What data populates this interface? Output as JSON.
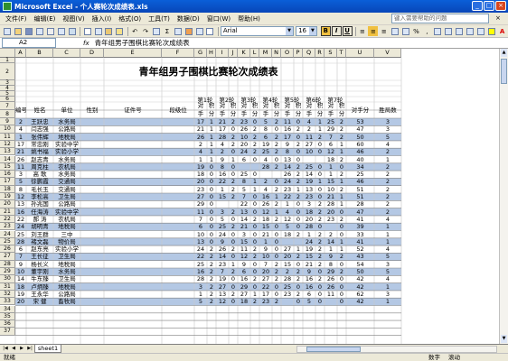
{
  "window": {
    "title": "Microsoft Excel - 个人赛轮次成绩表.xls"
  },
  "menu": {
    "items": [
      "文件(F)",
      "编辑(E)",
      "视图(V)",
      "插入(I)",
      "格式(O)",
      "工具(T)",
      "数据(D)",
      "窗口(W)",
      "帮助(H)"
    ],
    "ask_placeholder": "键入需要帮助的问题",
    "close_glyph": "×"
  },
  "toolbar": {
    "font_name": "Arial",
    "font_size": "16",
    "bold_label": "B",
    "italic_label": "I",
    "underline_label": "U",
    "zoom_sigma": "Σ"
  },
  "formula_bar": {
    "cell_ref": "A2",
    "fx": "fx",
    "value": "青年组男子围棋比赛轮次成绩表"
  },
  "sheet": {
    "columns": [
      "A",
      "B",
      "C",
      "D",
      "E",
      "F",
      "G",
      "H",
      "I",
      "J",
      "K",
      "L",
      "M",
      "N",
      "O",
      "P",
      "Q",
      "R",
      "S",
      "T",
      "U",
      "V"
    ],
    "row_numbers": [
      "1",
      "2",
      "3",
      "4",
      "5",
      "6",
      "7",
      "8",
      "9",
      "10",
      "11",
      "12",
      "13",
      "14",
      "15",
      "16",
      "17",
      "18",
      "19",
      "20",
      "21",
      "22",
      "23",
      "24",
      "25",
      "26",
      "27",
      "28",
      "29",
      "30",
      "31",
      "32",
      "33",
      "34",
      "35",
      "36",
      "37"
    ],
    "title": "青年组男子围棋比赛轮次成绩表",
    "headers": {
      "id": "编号",
      "name": "姓名",
      "unit": "单位",
      "gender": "性别",
      "cert": "证件号",
      "rank": "段级位",
      "rounds": [
        "第1轮",
        "第2轮",
        "第3轮",
        "第4轮",
        "第5轮",
        "第6轮",
        "第7轮"
      ],
      "opp": "对",
      "pts": "积",
      "opp2": "手",
      "pts2": "分",
      "opp_points": "对手分",
      "wins": "胜局数"
    },
    "rows": [
      {
        "id": "2",
        "name": "王跃忠",
        "unit": "水务局",
        "g": [
          "17",
          "1",
          "21",
          "2",
          "23",
          "0",
          "5",
          "2",
          "11",
          "0",
          "4",
          "1",
          "25",
          "2"
        ],
        "opp": "53",
        "win": "3"
      },
      {
        "id": "4",
        "name": "闫志强",
        "unit": "公路局",
        "g": [
          "21",
          "1",
          "17",
          "0",
          "26",
          "2",
          "8",
          "0",
          "16",
          "2",
          "2",
          "1",
          "29",
          "2"
        ],
        "opp": "47",
        "win": "3"
      },
      {
        "id": "1",
        "name": "张伟辉",
        "unit": "地税局",
        "g": [
          "26",
          "1",
          "28",
          "2",
          "10",
          "2",
          "6",
          "2",
          "17",
          "0",
          "11",
          "2",
          "7",
          "2"
        ],
        "opp": "50",
        "win": "5"
      },
      {
        "id": "17",
        "name": "常忠刚",
        "unit": "实验中学",
        "g": [
          "2",
          "1",
          "4",
          "2",
          "20",
          "2",
          "19",
          "2",
          "9",
          "2",
          "27",
          "0",
          "6",
          "1"
        ],
        "opp": "60",
        "win": "4"
      },
      {
        "id": "21",
        "name": "姚书福",
        "unit": "实验小学",
        "g": [
          "4",
          "1",
          "2",
          "0",
          "24",
          "2",
          "25",
          "2",
          "8",
          "0",
          "10",
          "0",
          "12",
          "1"
        ],
        "opp": "46",
        "win": "2"
      },
      {
        "id": "26",
        "name": "赵志青",
        "unit": "水务局",
        "g": [
          "1",
          "1",
          "9",
          "1",
          "6",
          "0",
          "4",
          "0",
          "13",
          "0",
          "",
          "",
          "18",
          "2"
        ],
        "opp": "40",
        "win": "1"
      },
      {
        "id": "11",
        "name": "周克柱",
        "unit": "农机局",
        "g": [
          "19",
          "0",
          "8",
          "0",
          "",
          "",
          "28",
          "2",
          "14",
          "2",
          "25",
          "0",
          "1",
          "0"
        ],
        "opp": "34",
        "win": "2"
      },
      {
        "id": "3",
        "name": "高 歌",
        "unit": "水务局",
        "g": [
          "18",
          "0",
          "16",
          "0",
          "25",
          "0",
          "",
          "",
          "26",
          "2",
          "14",
          "0",
          "1",
          "2"
        ],
        "opp": "25",
        "win": "2"
      },
      {
        "id": "5",
        "name": "徐鹏霞",
        "unit": "交通局",
        "g": [
          "20",
          "0",
          "22",
          "2",
          "8",
          "1",
          "2",
          "0",
          "24",
          "2",
          "19",
          "1",
          "15",
          "1"
        ],
        "opp": "46",
        "win": "2"
      },
      {
        "id": "8",
        "name": "毛长玉",
        "unit": "交通局",
        "g": [
          "23",
          "0",
          "1",
          "2",
          "5",
          "1",
          "4",
          "2",
          "23",
          "1",
          "13",
          "0",
          "10",
          "2"
        ],
        "opp": "51",
        "win": "2"
      },
      {
        "id": "12",
        "name": "李松高",
        "unit": "卫生局",
        "g": [
          "27",
          "0",
          "15",
          "2",
          "7",
          "0",
          "16",
          "1",
          "22",
          "2",
          "23",
          "0",
          "21",
          "1"
        ],
        "opp": "51",
        "win": "2"
      },
      {
        "id": "13",
        "name": "孙兆国",
        "unit": "公路局",
        "g": [
          "29",
          "0",
          "",
          "",
          "22",
          "0",
          "26",
          "2",
          "1",
          "0",
          "3",
          "2",
          "28",
          "1"
        ],
        "opp": "28",
        "win": "2"
      },
      {
        "id": "16",
        "name": "任海涛",
        "unit": "实验中学",
        "g": [
          "11",
          "0",
          "3",
          "2",
          "13",
          "0",
          "12",
          "1",
          "4",
          "0",
          "18",
          "2",
          "20",
          "0"
        ],
        "opp": "47",
        "win": "2"
      },
      {
        "id": "22",
        "name": "郝 涛",
        "unit": "农机局",
        "g": [
          "7",
          "0",
          "5",
          "0",
          "14",
          "2",
          "18",
          "2",
          "12",
          "0",
          "20",
          "2",
          "23",
          "2"
        ],
        "opp": "41",
        "win": "4"
      },
      {
        "id": "24",
        "name": "胡明青",
        "unit": "地税局",
        "g": [
          "6",
          "0",
          "25",
          "2",
          "21",
          "0",
          "15",
          "0",
          "5",
          "0",
          "28",
          "0",
          "",
          "0"
        ],
        "opp": "39",
        "win": "1"
      },
      {
        "id": "25",
        "name": "刘王群",
        "unit": "三中",
        "g": [
          "10",
          "0",
          "24",
          "0",
          "3",
          "0",
          "21",
          "0",
          "18",
          "2",
          "1",
          "2",
          "2",
          "0"
        ],
        "opp": "33",
        "win": "1"
      },
      {
        "id": "28",
        "name": "褚文磊",
        "unit": "物价局",
        "g": [
          "13",
          "0",
          "9",
          "0",
          "15",
          "0",
          "1",
          "0",
          "",
          "",
          "24",
          "2",
          "14",
          "1"
        ],
        "opp": "41",
        "win": "1"
      },
      {
        "id": "6",
        "name": "赵东亮",
        "unit": "实验小学",
        "g": [
          "24",
          "2",
          "26",
          "2",
          "11",
          "2",
          "9",
          "0",
          "27",
          "1",
          "19",
          "2",
          "1",
          "1"
        ],
        "opp": "52",
        "win": "4"
      },
      {
        "id": "7",
        "name": "王长征",
        "unit": "卫生局",
        "g": [
          "22",
          "2",
          "14",
          "0",
          "12",
          "2",
          "10",
          "0",
          "20",
          "2",
          "15",
          "2",
          "9",
          "2"
        ],
        "opp": "43",
        "win": "5"
      },
      {
        "id": "9",
        "name": "杨长义",
        "unit": "地税局",
        "g": [
          "25",
          "2",
          "23",
          "1",
          "9",
          "0",
          "7",
          "2",
          "15",
          "0",
          "21",
          "2",
          "8",
          "0"
        ],
        "opp": "54",
        "win": "3"
      },
      {
        "id": "10",
        "name": "董宇刚",
        "unit": "水务局",
        "g": [
          "16",
          "2",
          "7",
          "2",
          "6",
          "0",
          "20",
          "2",
          "2",
          "2",
          "9",
          "0",
          "29",
          "2"
        ],
        "opp": "50",
        "win": "5"
      },
      {
        "id": "14",
        "name": "牛东臻",
        "unit": "卫生局",
        "g": [
          "28",
          "2",
          "19",
          "0",
          "16",
          "2",
          "27",
          "2",
          "28",
          "2",
          "16",
          "2",
          "26",
          "0"
        ],
        "opp": "42",
        "win": "4"
      },
      {
        "id": "18",
        "name": "卢炳臻",
        "unit": "地税局",
        "g": [
          "3",
          "2",
          "27",
          "0",
          "29",
          "0",
          "22",
          "0",
          "25",
          "0",
          "16",
          "0",
          "26",
          "0"
        ],
        "opp": "42",
        "win": "1"
      },
      {
        "id": "19",
        "name": "王永华",
        "unit": "公路局",
        "g": [
          "1",
          "2",
          "13",
          "2",
          "27",
          "1",
          "17",
          "0",
          "23",
          "2",
          "6",
          "0",
          "11",
          "0"
        ],
        "opp": "62",
        "win": "3"
      },
      {
        "id": "20",
        "name": "宋 健",
        "unit": "畜牧局",
        "g": [
          "5",
          "2",
          "12",
          "0",
          "18",
          "2",
          "23",
          "2",
          "",
          "0",
          "5",
          "0",
          "",
          "0"
        ],
        "opp": "42",
        "win": "1"
      }
    ],
    "tab_label": "sheet1"
  },
  "status": {
    "left": "就绪",
    "num": "数字",
    "mode": "滚动"
  }
}
